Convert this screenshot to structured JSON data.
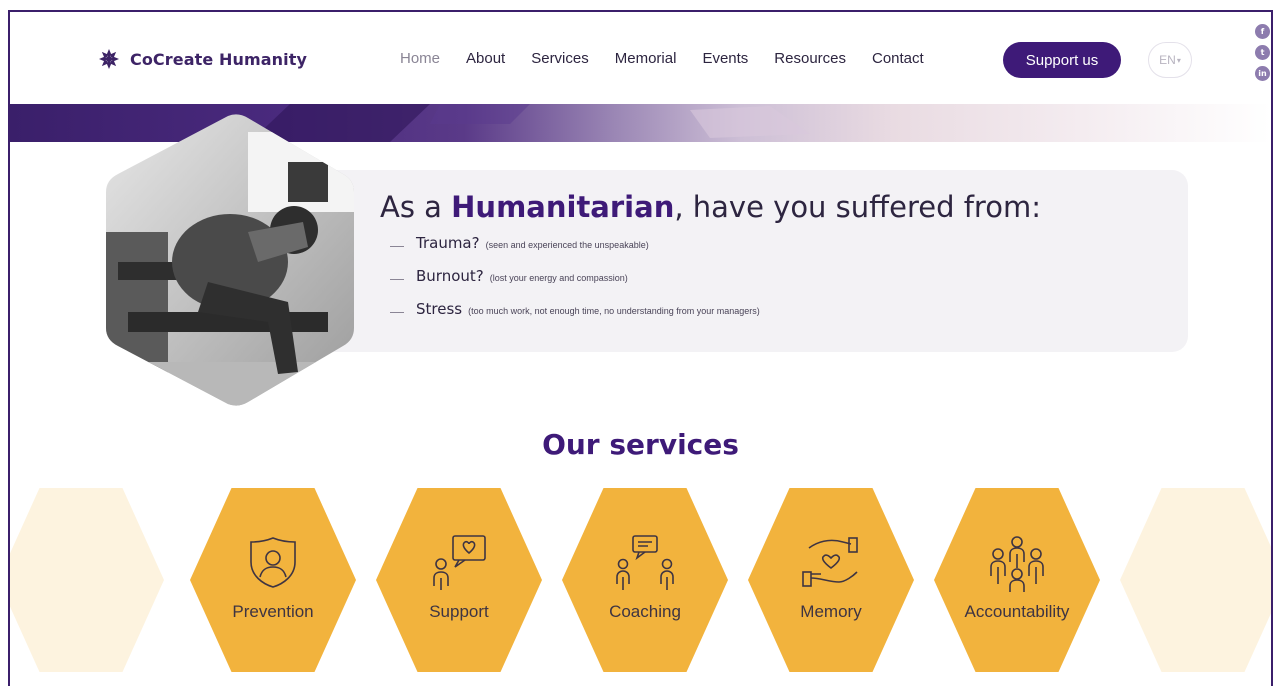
{
  "brand": {
    "name": "CoCreate Humanity",
    "icon": "asterisk-flower-icon"
  },
  "nav": {
    "items": [
      {
        "label": "Home",
        "active": true
      },
      {
        "label": "About"
      },
      {
        "label": "Services"
      },
      {
        "label": "Memorial"
      },
      {
        "label": "Events"
      },
      {
        "label": "Resources"
      },
      {
        "label": "Contact"
      }
    ],
    "support_label": "Support us",
    "language": "EN"
  },
  "social": [
    {
      "icon": "facebook-icon",
      "glyph": "f"
    },
    {
      "icon": "twitter-icon",
      "glyph": "t"
    },
    {
      "icon": "linkedin-icon",
      "glyph": "in"
    }
  ],
  "hero": {
    "title_prefix": "As a",
    "title_highlight": "Humanitarian",
    "title_suffix": ", have you suffered from:",
    "items": [
      {
        "term": "Trauma?",
        "note": "(seen and experienced the unspeakable)"
      },
      {
        "term": "Burnout?",
        "note": "(lost your energy and compassion)"
      },
      {
        "term": "Stress",
        "note": "(too much work, not enough time, no understanding from your managers)"
      }
    ]
  },
  "services": {
    "title": "Our services",
    "items": [
      {
        "label": "Prevention",
        "icon": "shield-person-icon"
      },
      {
        "label": "Support",
        "icon": "person-chat-heart-icon"
      },
      {
        "label": "Coaching",
        "icon": "two-people-chat-icon"
      },
      {
        "label": "Memory",
        "icon": "hands-heart-icon"
      },
      {
        "label": "Accountability",
        "icon": "group-people-icon"
      }
    ]
  },
  "colors": {
    "brand": "#3e1a78",
    "accent": "#f2b33d",
    "card": "#f3f2f5"
  }
}
